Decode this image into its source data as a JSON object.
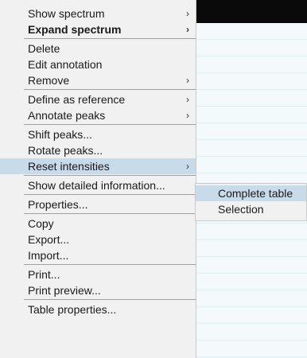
{
  "menu": {
    "items": [
      {
        "label": "Show spectrum",
        "arrow": "›"
      },
      {
        "label": "Expand spectrum",
        "arrow": "›"
      },
      {
        "label": "Delete"
      },
      {
        "label": "Edit annotation"
      },
      {
        "label": "Remove",
        "arrow": "›"
      },
      {
        "label": "Define as reference",
        "arrow": "›"
      },
      {
        "label": "Annotate peaks",
        "arrow": "›"
      },
      {
        "label": "Shift peaks..."
      },
      {
        "label": "Rotate peaks..."
      },
      {
        "label": "Reset intensities",
        "arrow": "›"
      },
      {
        "label": "Show detailed information..."
      },
      {
        "label": "Properties..."
      },
      {
        "label": "Copy"
      },
      {
        "label": "Export..."
      },
      {
        "label": "Import..."
      },
      {
        "label": "Print..."
      },
      {
        "label": "Print preview..."
      },
      {
        "label": "Table properties..."
      }
    ]
  },
  "submenu": {
    "items": [
      {
        "label": "Complete table"
      },
      {
        "label": "Selection"
      }
    ]
  },
  "colors": {
    "menu_background": "#f1f1f1",
    "highlight": "#c8dbeb",
    "separator": "#a0a0a0",
    "top_bar": "#0a0a0a",
    "table_background": "#f4fafb"
  }
}
